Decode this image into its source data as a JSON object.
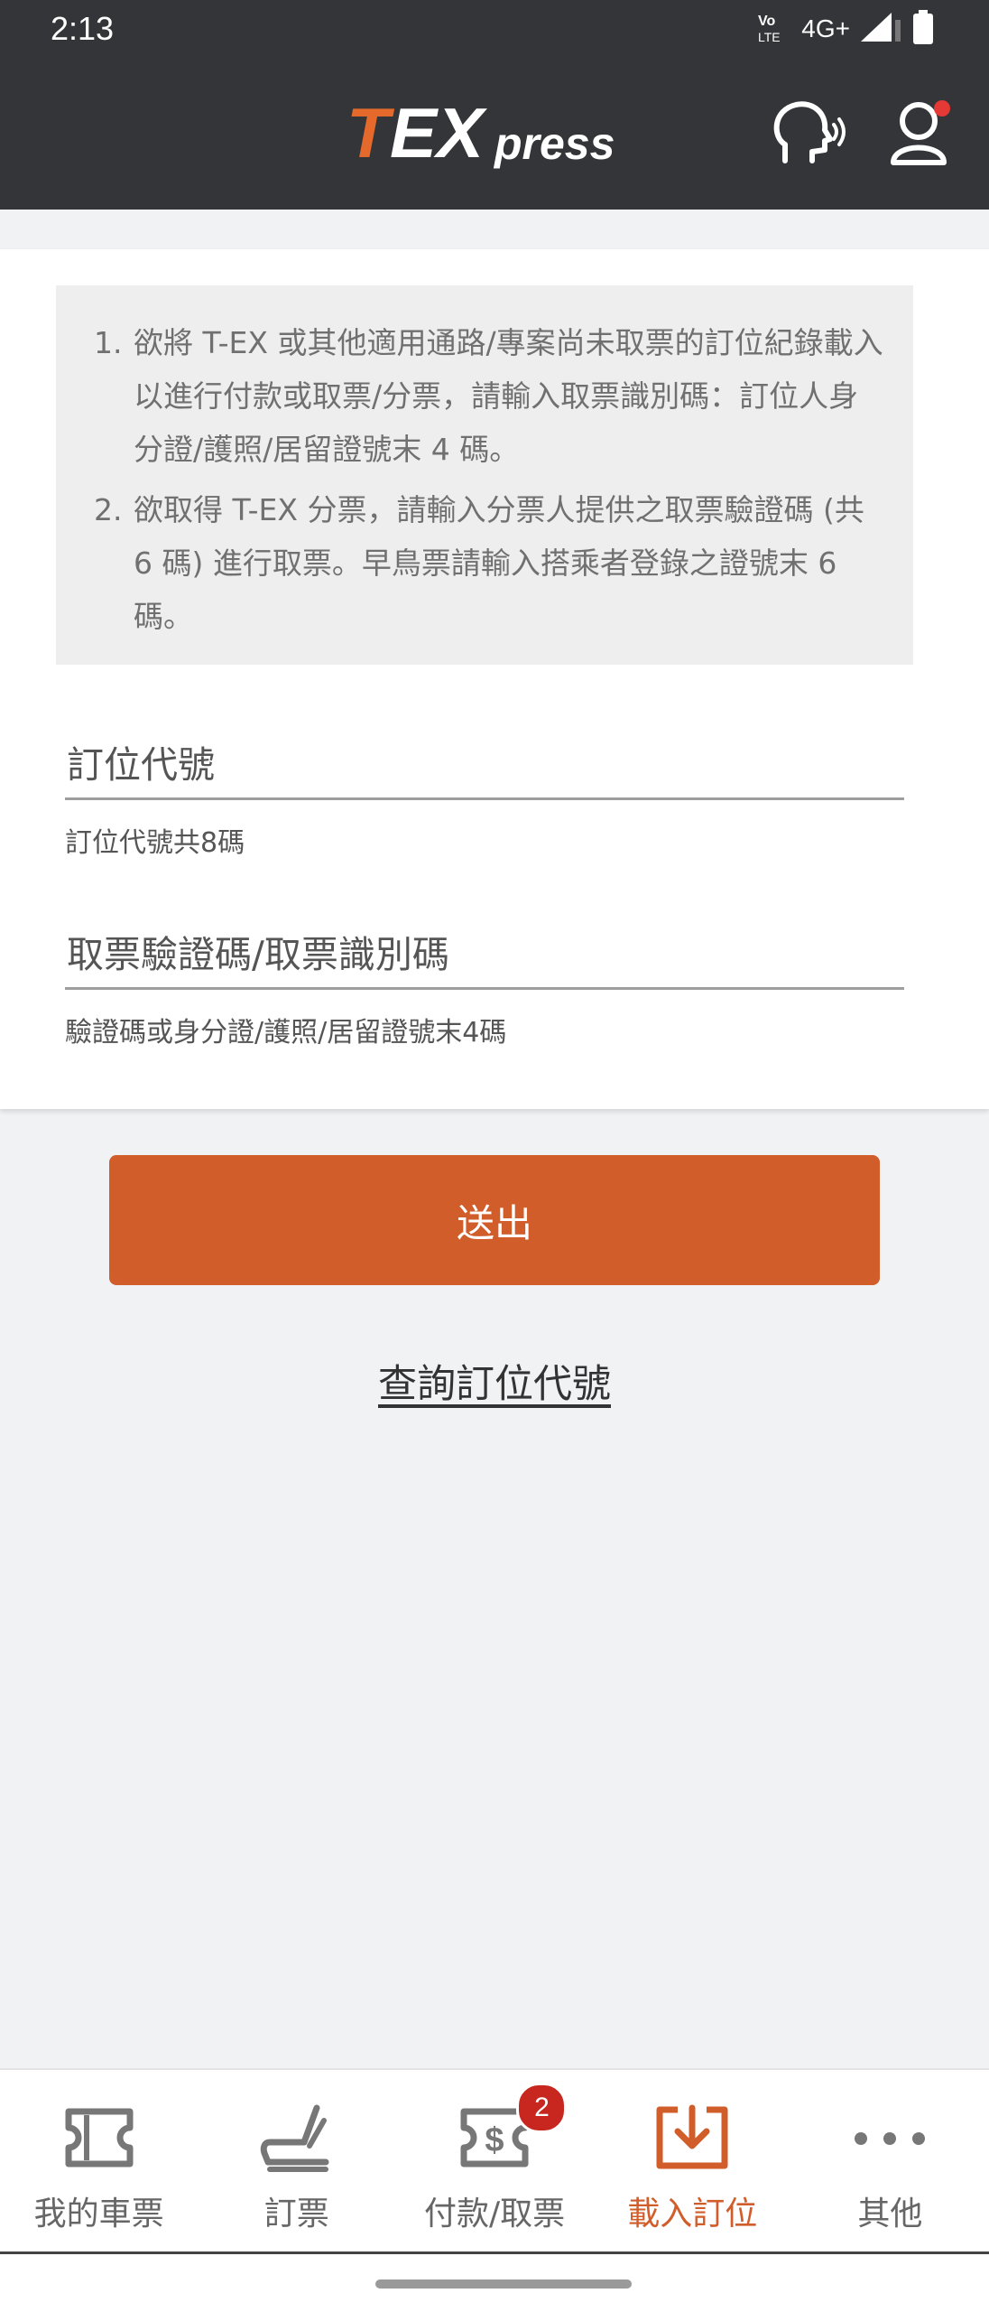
{
  "status_bar": {
    "time": "2:13",
    "network": "4G+",
    "volte": "Vo LTE"
  },
  "header": {
    "logo_text": "TEXpress",
    "icons": [
      "support-voice-icon",
      "account-icon"
    ],
    "notification_dot_color": "#e53935"
  },
  "notice": {
    "items": [
      {
        "number": "1.",
        "text": "欲將 T-EX 或其他適用通路/專案尚未取票的訂位紀錄載入以進行付款或取票/分票，請輸入取票識別碼：訂位人身分證/護照/居留證號末 4 碼。"
      },
      {
        "number": "2.",
        "text": "欲取得 T-EX 分票，請輸入分票人提供之取票驗證碼 (共 6 碼) 進行取票。早鳥票請輸入搭乘者登錄之證號末 6 碼。"
      }
    ]
  },
  "form": {
    "booking_code": {
      "placeholder": "訂位代號",
      "value": "",
      "hint": "訂位代號共8碼"
    },
    "verification_code": {
      "placeholder": "取票驗證碼/取票識別碼",
      "value": "",
      "hint": "驗證碼或身分證/護照/居留證號末4碼"
    },
    "submit_label": "送出",
    "lookup_link": "查詢訂位代號"
  },
  "bottom_nav": {
    "items": [
      {
        "label": "我的車票",
        "icon": "ticket-icon",
        "active": false
      },
      {
        "label": "訂票",
        "icon": "seat-icon",
        "active": false
      },
      {
        "label": "付款/取票",
        "icon": "payment-icon",
        "active": false,
        "badge": "2"
      },
      {
        "label": "載入訂位",
        "icon": "download-tray-icon",
        "active": true
      },
      {
        "label": "其他",
        "icon": "more-icon",
        "active": false
      }
    ]
  },
  "colors": {
    "accent": "#d05d2a",
    "header_bg": "#333538",
    "badge": "#c8271f"
  }
}
